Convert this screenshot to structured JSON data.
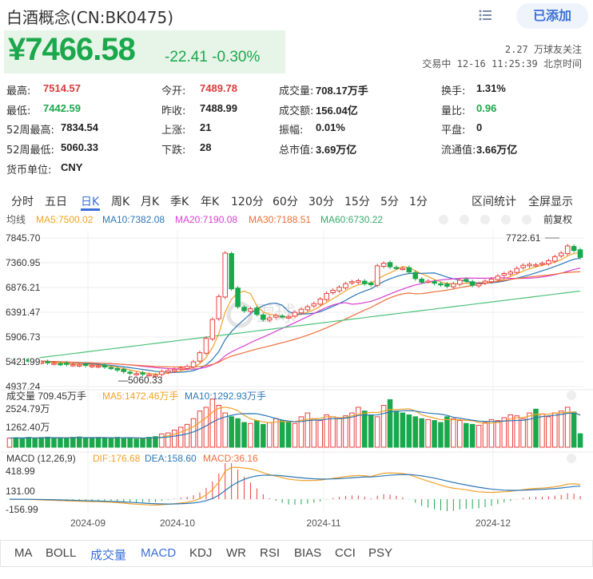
{
  "header": {
    "title": "白酒概念(CN:BK0475)",
    "add_button": "已添加"
  },
  "quote": {
    "price": "¥7466.58",
    "change": "-22.41 -0.30%",
    "followers": "2.27 万球友关注",
    "trade_status": "交易中 12-16 11:25:39 北京时间"
  },
  "stats": [
    {
      "label": "最高:",
      "value": "7514.57",
      "color": "#d93b3b"
    },
    {
      "label": "今开:",
      "value": "7489.78",
      "color": "#d93b3b"
    },
    {
      "label": "成交量:",
      "value": "708.17万手",
      "color": ""
    },
    {
      "label": "换手:",
      "value": "1.31%",
      "color": ""
    },
    {
      "label": "最低:",
      "value": "7442.59",
      "color": "#1ba84c"
    },
    {
      "label": "昨收:",
      "value": "7488.99",
      "color": ""
    },
    {
      "label": "成交额:",
      "value": "156.04亿",
      "color": ""
    },
    {
      "label": "量比:",
      "value": "0.96",
      "color": "#1ba84c"
    },
    {
      "label": "52周最高:",
      "value": "7834.54",
      "color": ""
    },
    {
      "label": "上涨:",
      "value": "21",
      "color": ""
    },
    {
      "label": "振幅:",
      "value": "0.01%",
      "color": ""
    },
    {
      "label": "平盘:",
      "value": "0",
      "color": ""
    },
    {
      "label": "52周最低:",
      "value": "5060.33",
      "color": ""
    },
    {
      "label": "下跌:",
      "value": "28",
      "color": ""
    },
    {
      "label": "总市值:",
      "value": "3.69万亿",
      "color": ""
    },
    {
      "label": "流通值:",
      "value": "3.66万亿",
      "color": ""
    },
    {
      "label": "货币单位:",
      "value": "CNY",
      "color": ""
    }
  ],
  "period_tabs": [
    "分时",
    "五日",
    "日K",
    "周K",
    "月K",
    "季K",
    "年K",
    "120分",
    "60分",
    "30分",
    "15分",
    "5分",
    "1分"
  ],
  "period_active": "日K",
  "right_tabs": {
    "range_stats": "区间统计",
    "fullscreen": "全屏显示"
  },
  "kline_legend": {
    "mode": "均线",
    "ma5": "MA5:7500.02",
    "ma10": "MA10:7382.08",
    "ma20": "MA20:7190.08",
    "ma30": "MA30:7188.51",
    "ma60": "MA60:6730.22",
    "adjust": "前复权"
  },
  "kline_axis": [
    "7845.70",
    "7360.95",
    "6876.21",
    "6391.47",
    "5906.73",
    "5421.99",
    "4937.24"
  ],
  "kline_annotations": {
    "high": "7722.61",
    "low": "5060.33"
  },
  "watermark": "雪球",
  "volume_legend": {
    "label": "成交量 709.45万手",
    "ma5": "MA5:1472.46万手",
    "ma10": "MA10:1292.93万手"
  },
  "volume_axis": [
    "2524.79万",
    "1262.40万"
  ],
  "macd_legend": {
    "label": "MACD (12,26,9)",
    "dif": "DIF:176.68",
    "dea": "DEA:158.60",
    "macd": "MACD:36.16"
  },
  "macd_axis": [
    "418.99",
    "131.00",
    "-156.99"
  ],
  "x_dates": [
    "2024-09",
    "2024-10",
    "2024-11",
    "2024-12"
  ],
  "indicator_tabs": [
    "MA",
    "BOLL",
    "成交量",
    "MACD",
    "KDJ",
    "WR",
    "RSI",
    "BIAS",
    "CCI",
    "PSY"
  ],
  "indicator_active": [
    "成交量",
    "MACD"
  ],
  "colors": {
    "up": "#e8403d",
    "down": "#1ba84c",
    "accent": "#3a6fd8",
    "ma5": "#f2a129",
    "ma10": "#2c77b6",
    "ma20": "#d83fd0",
    "ma30": "#ef6f3a",
    "ma60": "#4cc17a"
  },
  "chart_data": {
    "type": "candlestick",
    "ylim": [
      4937.24,
      7845.7
    ],
    "closes": [
      5458,
      5452,
      5440,
      5435,
      5420,
      5410,
      5400,
      5395,
      5380,
      5370,
      5365,
      5360,
      5350,
      5346,
      5340,
      5320,
      5300,
      5260,
      5230,
      5200,
      5190,
      5180,
      5170,
      5160,
      5230,
      5250,
      5270,
      5300,
      5330,
      5420,
      5600,
      5880,
      6250,
      6700,
      7550,
      6850,
      6500,
      6420,
      6460,
      6350,
      6250,
      6280,
      6330,
      6310,
      6300,
      6390,
      6450,
      6500,
      6560,
      6650,
      6760,
      6820,
      6880,
      6950,
      6990,
      7010,
      6950,
      6930,
      7300,
      7350,
      7280,
      7260,
      7250,
      7180,
      7050,
      6980,
      7000,
      6960,
      6930,
      6900,
      6950,
      7020,
      7000,
      6920,
      6950,
      7000,
      7040,
      7100,
      7150,
      7180,
      7250,
      7310,
      7330,
      7320,
      7350,
      7400,
      7480,
      7550,
      7690,
      7600,
      7466
    ],
    "volumes": [
      480,
      500,
      470,
      520,
      480,
      510,
      530,
      490,
      500,
      470,
      520,
      540,
      500,
      480,
      510,
      500,
      470,
      520,
      480,
      500,
      430,
      450,
      520,
      560,
      700,
      750,
      900,
      1050,
      1200,
      1500,
      1900,
      2100,
      2524,
      2200,
      1800,
      1600,
      1500,
      1300,
      1250,
      1400,
      1200,
      1300,
      1500,
      1400,
      1300,
      1250,
      1600,
      1800,
      1500,
      1400,
      1700,
      1600,
      1500,
      1650,
      1800,
      2100,
      1900,
      1700,
      1600,
      2200,
      2500,
      1900,
      1800,
      1700,
      1600,
      1500,
      1450,
      1400,
      1300,
      1600,
      1500,
      1400,
      1250,
      1200,
      1150,
      1300,
      1450,
      1400,
      1550,
      1700,
      1650,
      1500,
      1800,
      2000,
      1750,
      1600,
      1800,
      1900,
      2100,
      1850,
      709
    ]
  }
}
